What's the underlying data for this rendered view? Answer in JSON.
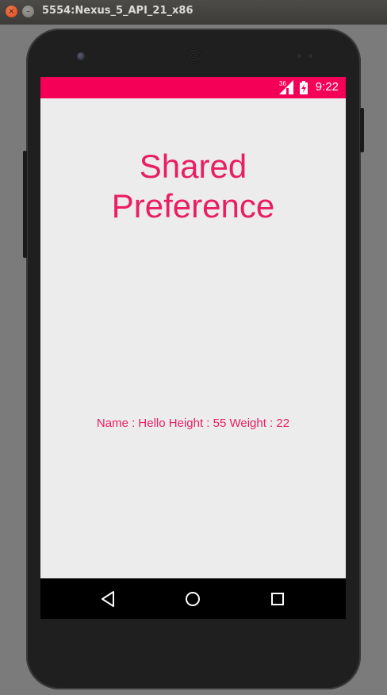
{
  "window": {
    "title": "5554:Nexus_5_API_21_x86",
    "close_glyph": "×",
    "minimize_glyph": "–"
  },
  "status_bar": {
    "network_label": "36",
    "time": "9:22",
    "color": "#f50057"
  },
  "app": {
    "heading_line1": "Shared",
    "heading_line2": "Preference",
    "info_text": "Name : Hello Height : 55 Weight : 22",
    "accent_color": "#e91e63",
    "background_color": "#ececec"
  },
  "nav_bar": {
    "icons": [
      "back-icon",
      "home-icon",
      "recents-icon"
    ]
  }
}
